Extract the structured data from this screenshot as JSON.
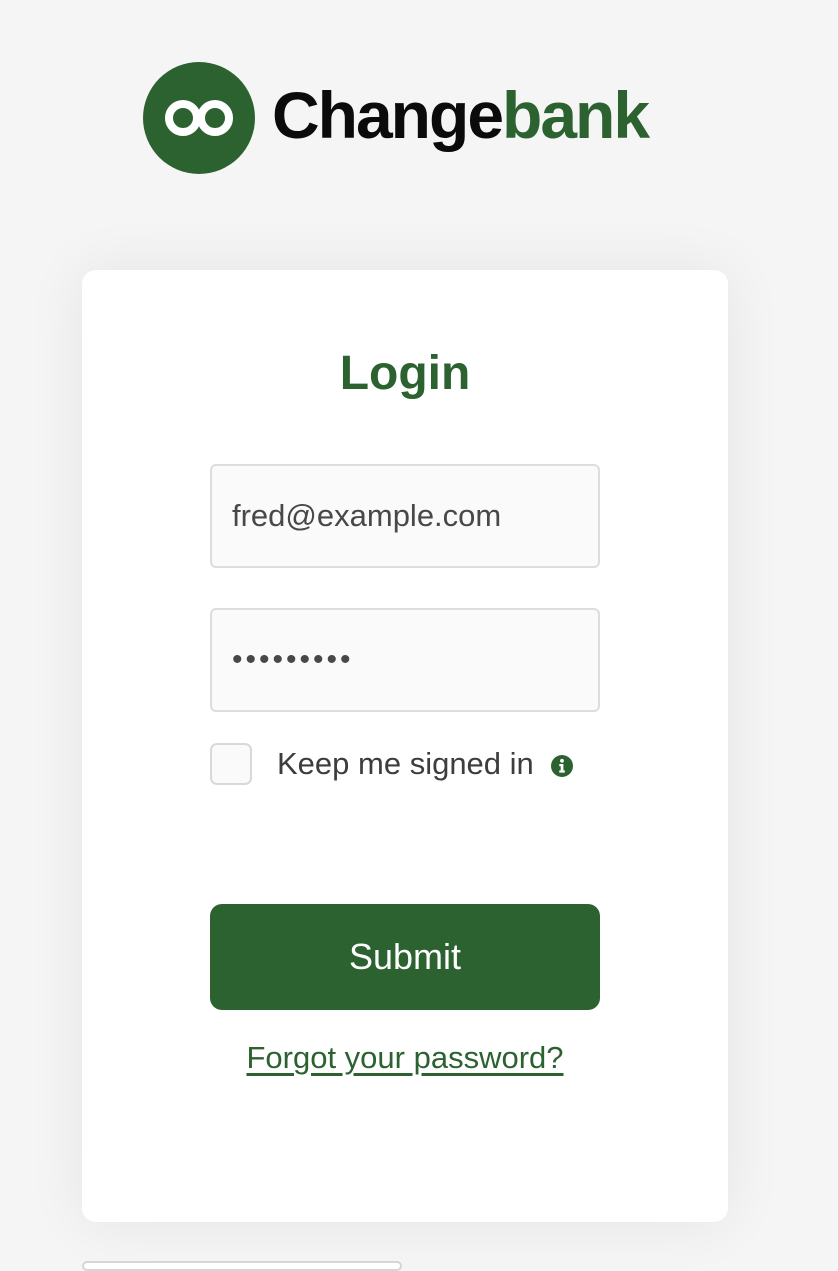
{
  "brand": {
    "name_part1": "Change",
    "name_part2": "bank",
    "logo_icon": "infinity-circle-icon",
    "primary_color": "#2c6230",
    "text_color": "#0b0b0b"
  },
  "login": {
    "title": "Login",
    "email": {
      "value": "fred@example.com"
    },
    "password": {
      "value": "•••••••••"
    },
    "remember": {
      "label": "Keep me signed in",
      "checked": false,
      "info_icon": "info-circle-icon"
    },
    "submit_label": "Submit",
    "forgot_label": "Forgot your password?"
  },
  "colors": {
    "page_background": "#f5f5f5",
    "card_background": "#ffffff",
    "input_border": "#dddddd"
  }
}
